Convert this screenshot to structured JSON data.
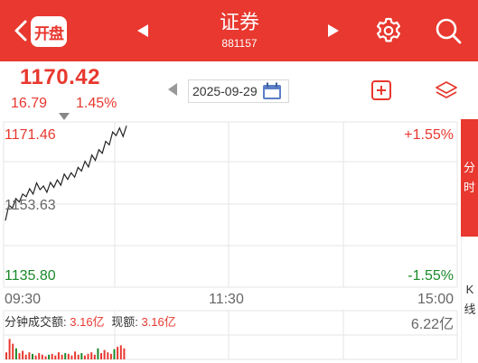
{
  "header": {
    "badge_label": "开盘",
    "title": "证券",
    "code": "881157"
  },
  "quote": {
    "price": "1170.42",
    "change": "16.79",
    "change_pct": "1.45%",
    "date": "2025-09-29"
  },
  "chart_labels": {
    "high_price": "1171.46",
    "high_pct": "+1.55%",
    "mid_price": "1153.63",
    "low_price": "1135.80",
    "low_pct": "-1.55%",
    "time_start": "09:30",
    "time_mid": "11:30",
    "time_end": "15:00",
    "volume_label": "分钟成交额:",
    "volume_value": "3.16亿",
    "current_label": "现额:",
    "current_value": "3.16亿",
    "volume_max": "6.22亿"
  },
  "side_tabs": {
    "intraday": [
      "分",
      "时"
    ],
    "kline": [
      "K",
      "线"
    ]
  },
  "colors": {
    "brand": "#e8382f",
    "up": "#e8382f",
    "down": "#1a8a2a",
    "grid": "#e6e6e6"
  },
  "chart_data": {
    "type": "line",
    "y_range": [
      1135.8,
      1171.46
    ],
    "y_reference": 1153.63,
    "x_labels": [
      "09:30",
      "11:30",
      "15:00"
    ],
    "price_series": [
      1150.0,
      1153.5,
      1152.8,
      1155.0,
      1154.2,
      1156.0,
      1155.4,
      1157.2,
      1156.0,
      1158.5,
      1157.0,
      1157.8,
      1156.4,
      1158.6,
      1157.5,
      1159.2,
      1158.0,
      1160.5,
      1159.3,
      1160.8,
      1159.8,
      1162.0,
      1161.2,
      1163.4,
      1162.1,
      1164.8,
      1163.6,
      1166.0,
      1165.2,
      1167.9,
      1167.1,
      1170.0,
      1169.2,
      1170.9,
      1169.0,
      1171.4
    ],
    "volume_series": [
      0.9,
      2.6,
      2.0,
      1.4,
      0.8,
      1.1,
      0.6,
      0.9,
      0.7,
      0.5,
      0.8,
      0.6,
      0.4,
      0.6,
      0.7,
      0.5,
      0.9,
      0.6,
      0.8,
      0.7,
      0.5,
      1.0,
      0.6,
      0.8,
      0.5,
      0.7,
      0.9,
      0.6,
      1.4,
      0.8,
      1.2,
      0.9,
      0.7,
      1.3,
      1.6,
      1.8,
      1.4
    ],
    "volume_range": [
      0,
      6.22
    ]
  }
}
